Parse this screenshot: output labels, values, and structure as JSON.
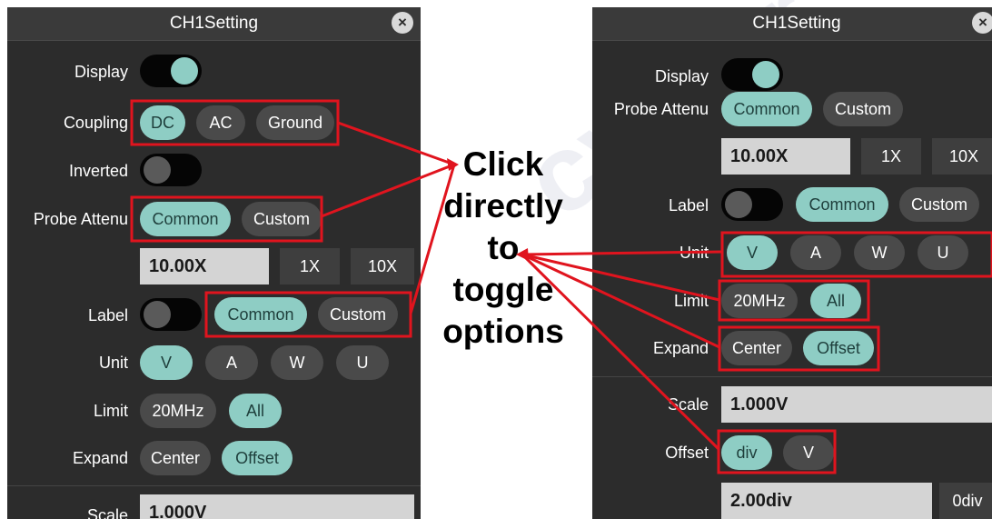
{
  "left_panel": {
    "title": "CH1Setting",
    "close_glyph": "×",
    "display_label": "Display",
    "coupling": {
      "label": "Coupling",
      "options": [
        "DC",
        "AC",
        "Ground"
      ],
      "selected": "DC"
    },
    "inverted_label": "Inverted",
    "probe_attenu": {
      "label": "Probe Attenu",
      "options": [
        "Common",
        "Custom"
      ],
      "selected": "Common",
      "value": "10.00X",
      "buttons": [
        "1X",
        "10X"
      ]
    },
    "label_row": {
      "label": "Label",
      "options": [
        "Common",
        "Custom"
      ],
      "selected": "Common"
    },
    "unit": {
      "label": "Unit",
      "options": [
        "V",
        "A",
        "W",
        "U"
      ],
      "selected": "V"
    },
    "limit": {
      "label": "Limit",
      "options": [
        "20MHz",
        "All"
      ],
      "selected": "All"
    },
    "expand": {
      "label": "Expand",
      "options": [
        "Center",
        "Offset"
      ],
      "selected": "Offset"
    },
    "scale": {
      "label": "Scale",
      "value": "1.000V"
    }
  },
  "right_panel": {
    "title": "CH1Setting",
    "close_glyph": "×",
    "display_label": "Display",
    "probe_attenu": {
      "label": "Probe Attenu",
      "options": [
        "Common",
        "Custom"
      ],
      "selected": "Common",
      "value": "10.00X",
      "buttons": [
        "1X",
        "10X"
      ]
    },
    "label_row": {
      "label": "Label",
      "options": [
        "Common",
        "Custom"
      ],
      "selected": "Common"
    },
    "unit": {
      "label": "Unit",
      "options": [
        "V",
        "A",
        "W",
        "U"
      ],
      "selected": "V"
    },
    "limit": {
      "label": "Limit",
      "options": [
        "20MHz",
        "All"
      ],
      "selected": "All"
    },
    "expand": {
      "label": "Expand",
      "options": [
        "Center",
        "Offset"
      ],
      "selected": "Offset"
    },
    "scale": {
      "label": "Scale",
      "value": "1.000V"
    },
    "offset": {
      "label": "Offset",
      "options": [
        "div",
        "V"
      ],
      "selected": "div",
      "value": "2.00div",
      "button": "0div"
    }
  },
  "callout": {
    "lines": [
      "Click",
      "directly",
      "to",
      "toggle",
      "options"
    ]
  },
  "colors": {
    "panel": "#2c2c2c",
    "accent": "#8ecdc4",
    "highlight": "#e0141e",
    "pill_inactive": "#4a4a4a"
  }
}
